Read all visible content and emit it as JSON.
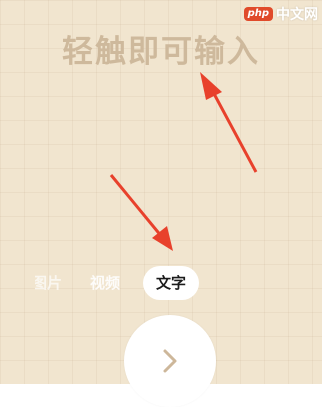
{
  "prompt": {
    "text": "轻触即可输入"
  },
  "watermark": {
    "badge": "php",
    "text": "中文网"
  },
  "modes": {
    "photo_label": "图片",
    "video_label": "视频",
    "text_label": "文字",
    "selected": "文字"
  },
  "next_button": {
    "icon": "chevron-right-icon"
  },
  "colors": {
    "background": "#F1E5CF",
    "prompt_text": "#CDB79A",
    "arrow": "#E8412C",
    "selected_pill": "#FFFFFF"
  }
}
